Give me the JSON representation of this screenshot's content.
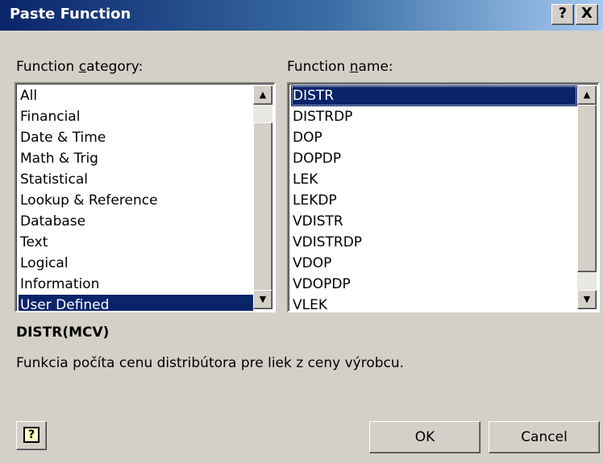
{
  "window": {
    "title": "Paste Function",
    "help_label": "?",
    "close_label": "X"
  },
  "category": {
    "label_pre": "Function ",
    "label_key": "c",
    "label_post": "ategory:",
    "items": [
      "All",
      "Financial",
      "Date & Time",
      "Math & Trig",
      "Statistical",
      "Lookup & Reference",
      "Database",
      "Text",
      "Logical",
      "Information",
      "User Defined"
    ],
    "selected": "User Defined"
  },
  "function": {
    "label_pre": "Function ",
    "label_key": "n",
    "label_post": "ame:",
    "items": [
      "DISTR",
      "DISTRDP",
      "DOP",
      "DOPDP",
      "LEK",
      "LEKDP",
      "VDISTR",
      "VDISTRDP",
      "VDOP",
      "VDOPDP",
      "VLEK"
    ],
    "selected": "DISTR"
  },
  "syntax": "DISTR(MCV)",
  "description": "Funkcia počíta cenu distribútora pre liek z ceny výrobcu.",
  "buttons": {
    "assistant_icon": "help-assistant-icon",
    "ok": "OK",
    "cancel": "Cancel"
  },
  "colors": {
    "title_gradient_start": "#0a246a",
    "title_gradient_end": "#a6caf0",
    "selection": "#0a246a",
    "face": "#d4d0c8"
  }
}
